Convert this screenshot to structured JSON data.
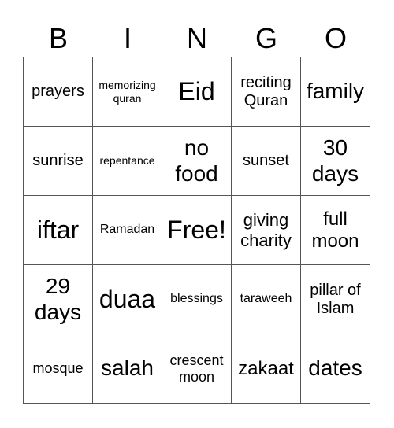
{
  "header": [
    "B",
    "I",
    "N",
    "G",
    "O"
  ],
  "cells": [
    {
      "text": "prayers",
      "size": "s20"
    },
    {
      "text": "memorizing quran",
      "size": "s14"
    },
    {
      "text": "Eid",
      "size": "s32"
    },
    {
      "text": "reciting Quran",
      "size": "s20"
    },
    {
      "text": "family",
      "size": "s28"
    },
    {
      "text": "sunrise",
      "size": "s20"
    },
    {
      "text": "repentance",
      "size": "s14"
    },
    {
      "text": "no food",
      "size": "s28"
    },
    {
      "text": "sunset",
      "size": "s20"
    },
    {
      "text": "30 days",
      "size": "s28"
    },
    {
      "text": "iftar",
      "size": "s32"
    },
    {
      "text": "Ramadan",
      "size": "s16"
    },
    {
      "text": "Free!",
      "size": "s32"
    },
    {
      "text": "giving charity",
      "size": "s22"
    },
    {
      "text": "full moon",
      "size": "s24"
    },
    {
      "text": "29 days",
      "size": "s28"
    },
    {
      "text": "duaa",
      "size": "s32"
    },
    {
      "text": "blessings",
      "size": "s16"
    },
    {
      "text": "taraweeh",
      "size": "s16"
    },
    {
      "text": "pillar of Islam",
      "size": "s20"
    },
    {
      "text": "mosque",
      "size": "s18"
    },
    {
      "text": "salah",
      "size": "s28"
    },
    {
      "text": "crescent moon",
      "size": "s18"
    },
    {
      "text": "zakaat",
      "size": "s24"
    },
    {
      "text": "dates",
      "size": "s28"
    }
  ]
}
